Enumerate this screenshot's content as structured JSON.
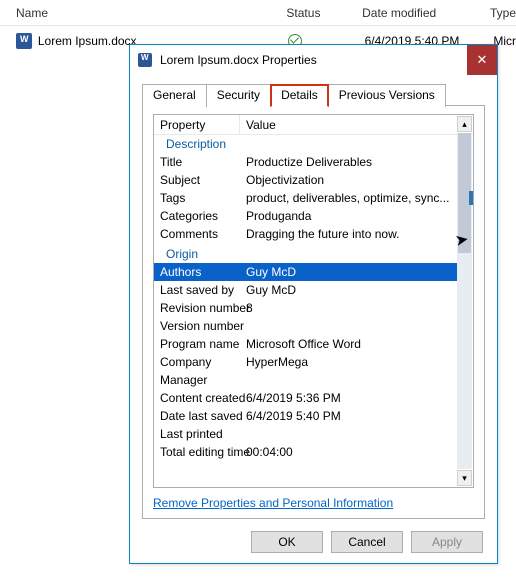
{
  "explorer": {
    "columns": {
      "name": "Name",
      "status": "Status",
      "date": "Date modified",
      "type": "Type"
    },
    "file": {
      "name": "Lorem Ipsum.docx",
      "date": "6/4/2019 5:40 PM",
      "type": "Micr"
    }
  },
  "dialog": {
    "title": "Lorem Ipsum.docx Properties",
    "close_label": "✕",
    "tabs": {
      "general": "General",
      "security": "Security",
      "details": "Details",
      "previous": "Previous Versions"
    },
    "columns": {
      "property": "Property",
      "value": "Value"
    },
    "groups": {
      "description": {
        "label": "Description",
        "title": {
          "prop": "Title",
          "value": "Productize Deliverables"
        },
        "subject": {
          "prop": "Subject",
          "value": "Objectivization"
        },
        "tags": {
          "prop": "Tags",
          "value": "product, deliverables, optimize, sync..."
        },
        "categories": {
          "prop": "Categories",
          "value": "Produganda"
        },
        "comments": {
          "prop": "Comments",
          "value": "Dragging the future into now."
        }
      },
      "origin": {
        "label": "Origin",
        "authors": {
          "prop": "Authors",
          "value": "Guy McD"
        },
        "last_saved_by": {
          "prop": "Last saved by",
          "value": "Guy McD"
        },
        "revision_number": {
          "prop": "Revision number",
          "value": "8"
        },
        "version_number": {
          "prop": "Version number",
          "value": ""
        },
        "program_name": {
          "prop": "Program name",
          "value": "Microsoft Office Word"
        },
        "company": {
          "prop": "Company",
          "value": "HyperMega"
        },
        "manager": {
          "prop": "Manager",
          "value": ""
        },
        "content_created": {
          "prop": "Content created",
          "value": "6/4/2019 5:36 PM"
        },
        "date_last_saved": {
          "prop": "Date last saved",
          "value": "6/4/2019 5:40 PM"
        },
        "last_printed": {
          "prop": "Last printed",
          "value": ""
        },
        "total_editing": {
          "prop": "Total editing time",
          "value": "00:04:00"
        }
      }
    },
    "remove_link": "Remove Properties and Personal Information",
    "buttons": {
      "ok": "OK",
      "cancel": "Cancel",
      "apply": "Apply"
    }
  }
}
